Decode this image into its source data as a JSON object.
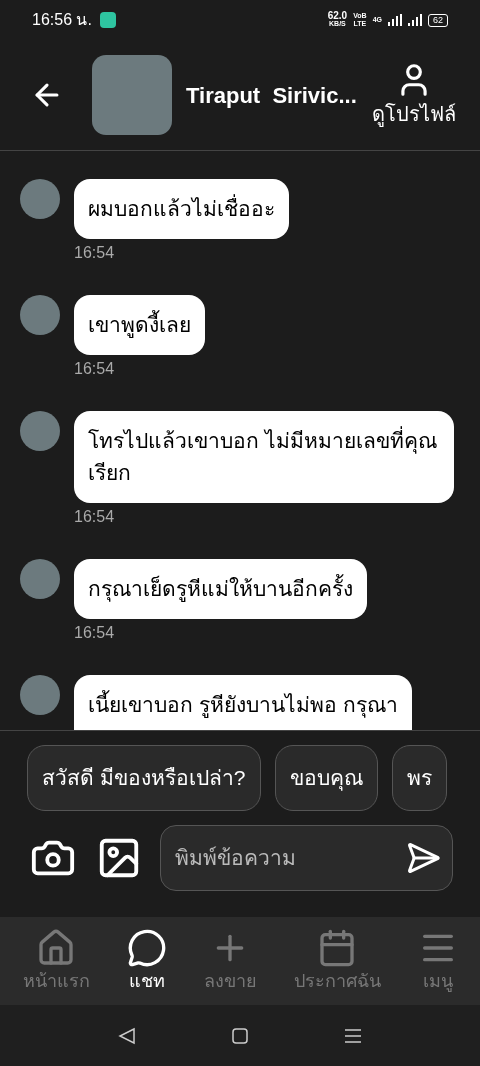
{
  "status_bar": {
    "time": "16:56 น.",
    "speed": "62.0",
    "speed_unit": "KB/S",
    "volte_top": "VoB",
    "volte_bottom": "LTE",
    "network": "4G",
    "battery": "62"
  },
  "header": {
    "name": "Tiraput  Sirivic...",
    "profile_label": "ดูโปรไฟล์"
  },
  "messages": [
    {
      "text": "ผมบอกแล้วไม่เชื่ออะ",
      "time": "16:54"
    },
    {
      "text": "เขาพูดงี้เลย",
      "time": "16:54"
    },
    {
      "text": "โทรไปแล้วเขาบอก ไม่มีหมายเลขที่คุณเรียก",
      "time": "16:54"
    },
    {
      "text": "กรุณาเย็ดรูหีแม่ให้บานอีกครั้ง",
      "time": "16:54"
    },
    {
      "text": "เนี้ยเขาบอก รูหียังบานไม่พอ กรุณา"
    }
  ],
  "quick_replies": [
    "สวัสดี มีของหรือเปล่า?",
    "ขอบคุณ",
    "พร"
  ],
  "composer": {
    "placeholder": "พิมพ์ข้อความ"
  },
  "nav": [
    {
      "kind": "home",
      "label": "หน้าแรก",
      "selected": false
    },
    {
      "kind": "chat",
      "label": "แชท",
      "selected": true
    },
    {
      "kind": "plus",
      "label": "ลงขาย",
      "selected": false
    },
    {
      "kind": "calendar",
      "label": "ประกาศฉัน",
      "selected": false
    },
    {
      "kind": "menu",
      "label": "เมนู",
      "selected": false
    }
  ]
}
